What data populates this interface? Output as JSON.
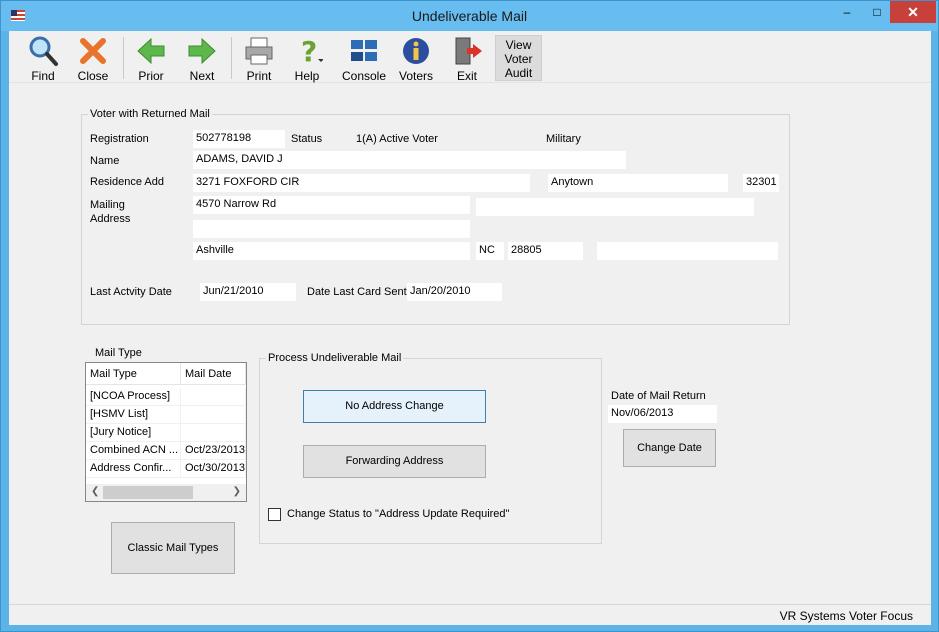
{
  "window": {
    "title": "Undeliverable Mail",
    "minimize": "–",
    "maximize": "□",
    "close": "✕"
  },
  "toolbar": {
    "find": "Find",
    "close": "Close",
    "prior": "Prior",
    "next": "Next",
    "print": "Print",
    "help": "Help",
    "console": "Console",
    "voters": "Voters",
    "exit": "Exit",
    "view_voter_audit": [
      "View",
      "Voter",
      "Audit"
    ]
  },
  "voter": {
    "group_title": "Voter with Returned Mail",
    "registration_label": "Registration",
    "registration": "502778198",
    "status_label": "Status",
    "status": "1(A) Active Voter",
    "military_label": "Military",
    "name_label": "Name",
    "name": "ADAMS, DAVID J",
    "residence_label": "Residence Add",
    "residence_street": "3271 FOXFORD CIR",
    "residence_city": "Anytown",
    "residence_zip": "32301",
    "mailing_label": [
      "Mailing",
      "Address"
    ],
    "mailing_line1": "4570 Narrow Rd",
    "mailing_line2": "",
    "mailing_line3": "",
    "mailing_city": "Ashville",
    "mailing_state": "NC",
    "mailing_zip": "28805",
    "mailing_extra": "",
    "last_activity_label": "Last Actvity Date",
    "last_activity": "Jun/21/2010",
    "last_card_label": "Date Last Card Sent",
    "last_card": "Jan/20/2010"
  },
  "mail_type": {
    "group_title": "Mail Type",
    "columns": [
      "Mail Type",
      "Mail Date"
    ],
    "rows": [
      {
        "type": "[NCOA Process]",
        "date": ""
      },
      {
        "type": "[HSMV List]",
        "date": ""
      },
      {
        "type": "[Jury Notice]",
        "date": ""
      },
      {
        "type": "Combined ACN ...",
        "date": "Oct/23/2013"
      },
      {
        "type": "Address Confir...",
        "date": "Oct/30/2013"
      }
    ],
    "classic_button": "Classic Mail Types"
  },
  "process": {
    "group_title": "Process Undeliverable Mail",
    "no_address_change": "No Address Change",
    "forwarding_address": "Forwarding Address",
    "change_status_label": "Change Status to \"Address Update Required\""
  },
  "mail_return": {
    "label": "Date of Mail Return",
    "date": "Nov/06/2013",
    "change_date_button": "Change Date"
  },
  "statusbar": {
    "text": "VR Systems Voter Focus"
  }
}
